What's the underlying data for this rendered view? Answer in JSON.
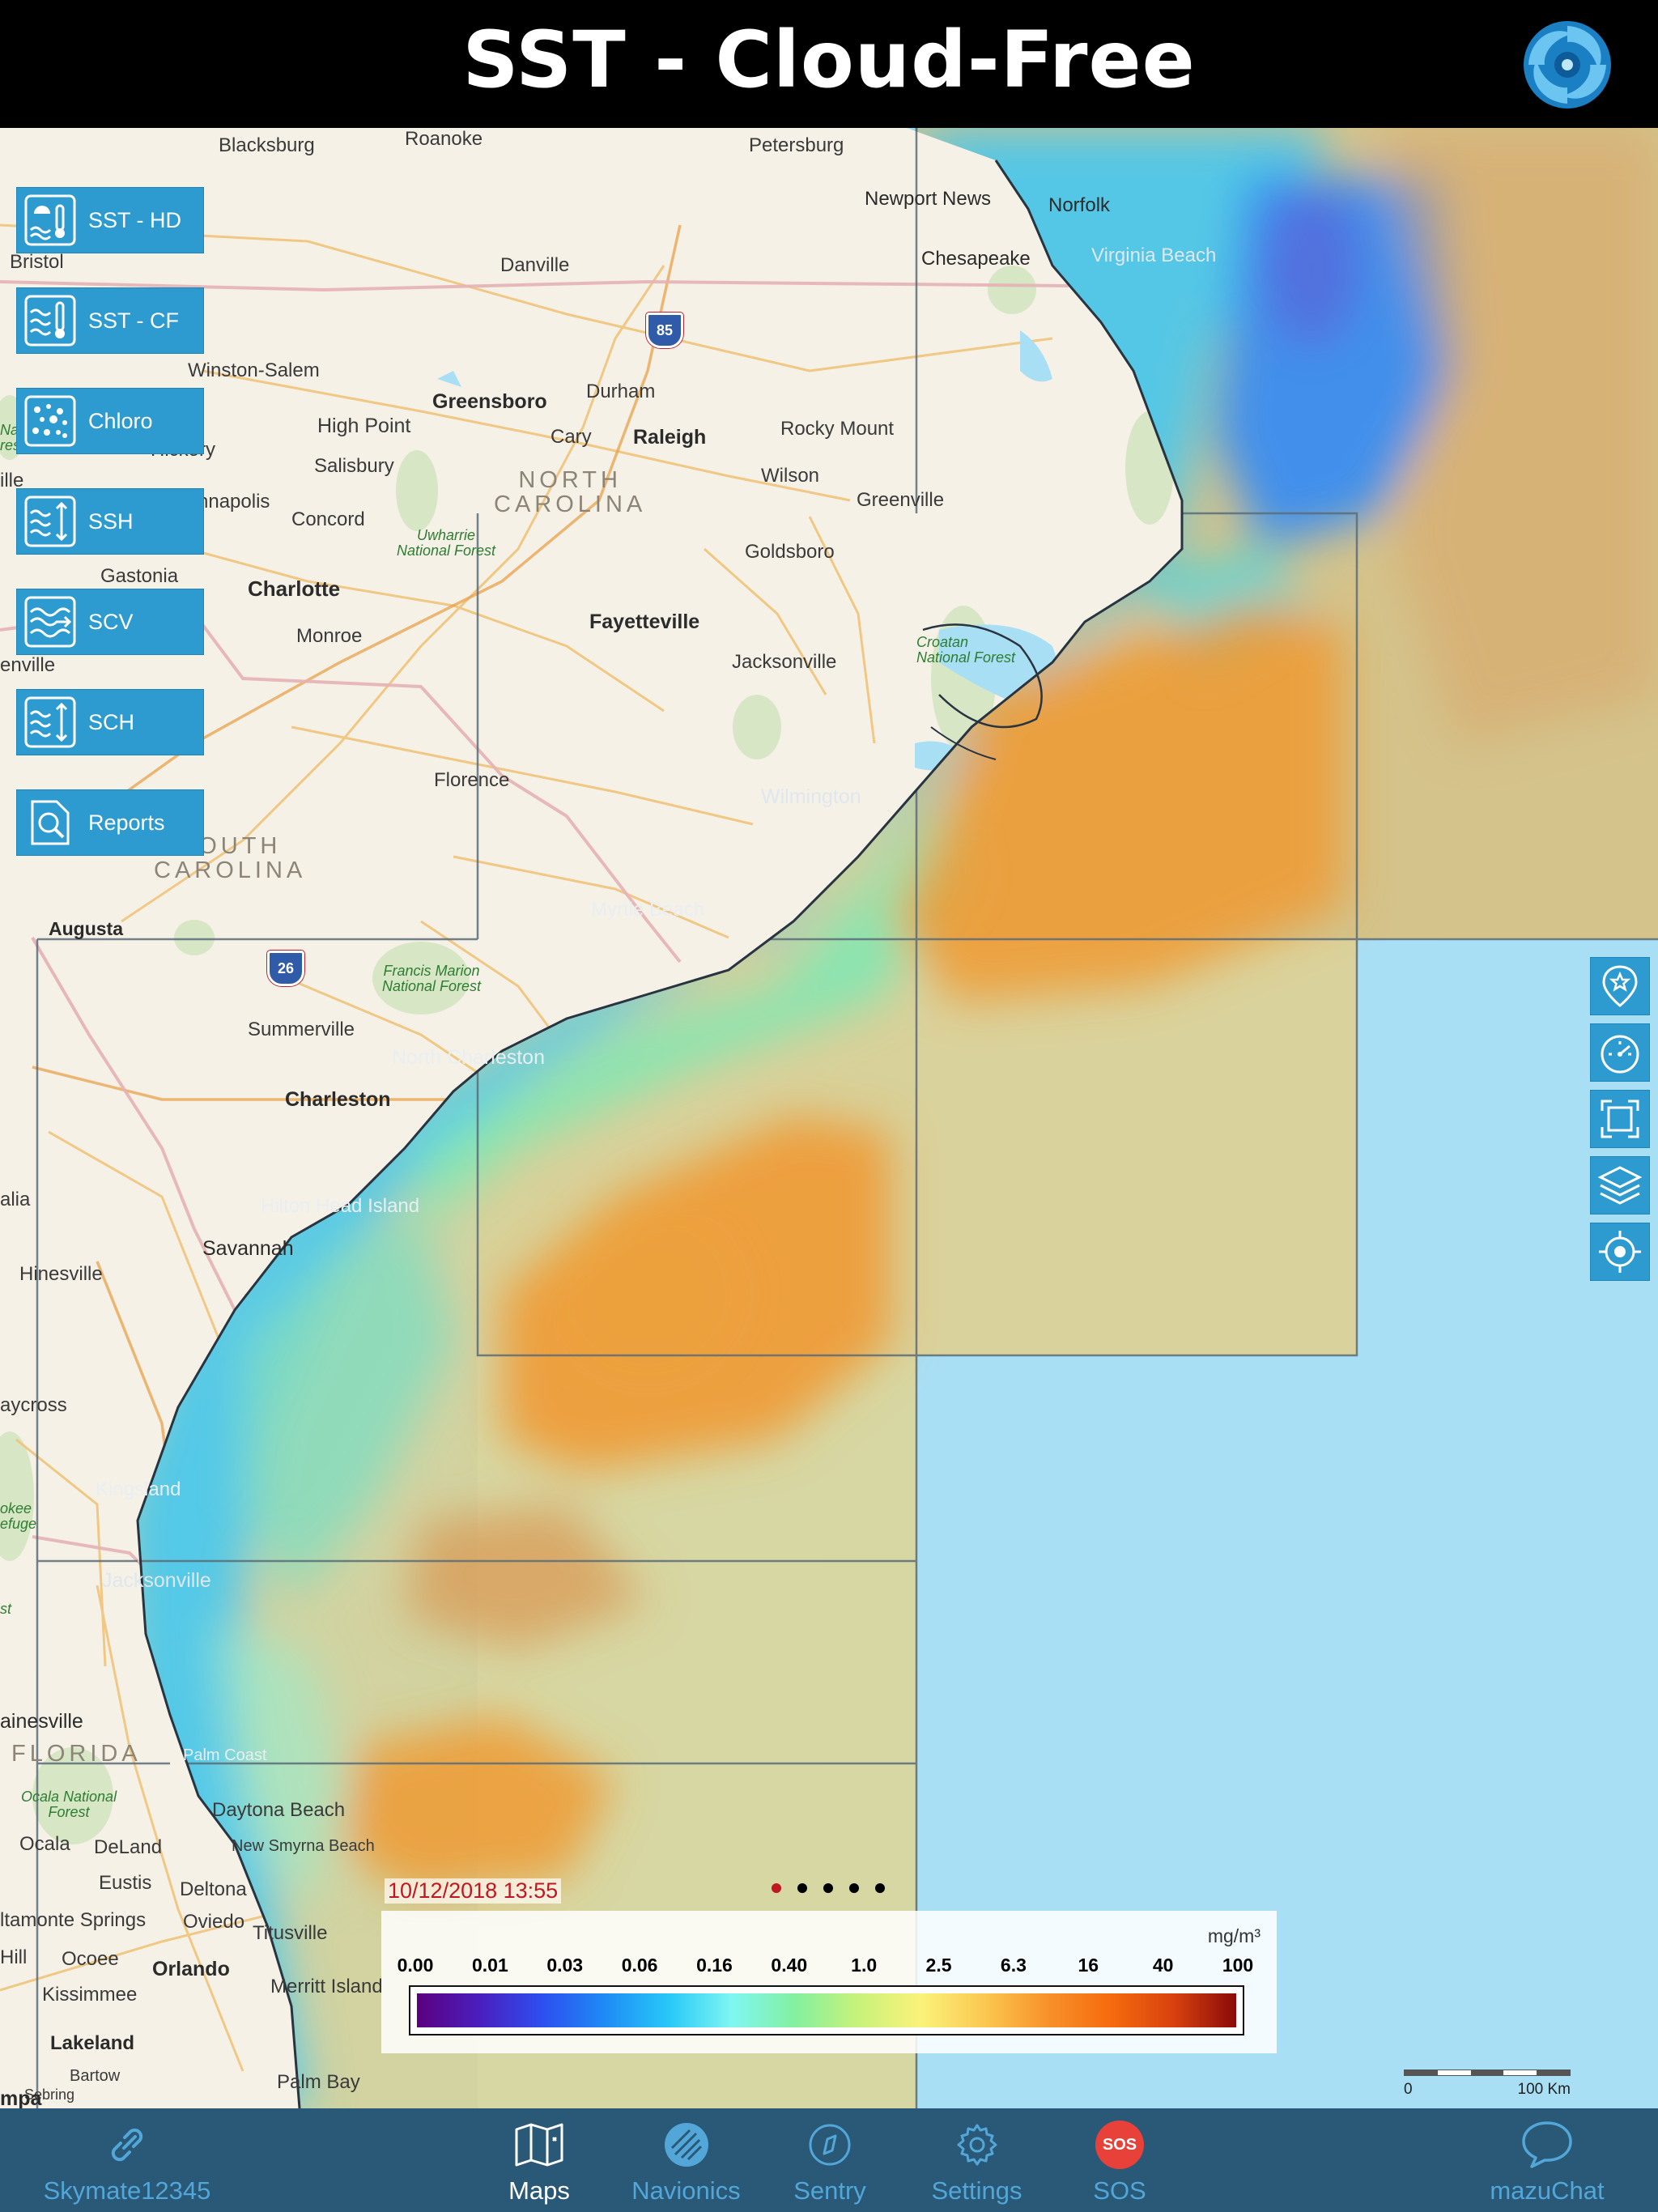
{
  "header": {
    "title": "SST - Cloud-Free",
    "logo_icon": "swirl-logo-icon"
  },
  "left_buttons": [
    {
      "label": "SST - HD",
      "icon": "thermometer-sun-icon"
    },
    {
      "label": "SST - CF",
      "icon": "thermometer-waves-icon"
    },
    {
      "label": "Chloro",
      "icon": "dots-icon"
    },
    {
      "label": "SSH",
      "icon": "waves-updown-icon"
    },
    {
      "label": "SCV",
      "icon": "waves-arrow-icon"
    },
    {
      "label": "SCH",
      "icon": "waves-updown-icon"
    },
    {
      "label": "Reports",
      "icon": "document-search-icon"
    }
  ],
  "right_buttons": [
    {
      "icon": "pin-star-icon"
    },
    {
      "icon": "speedometer-icon"
    },
    {
      "icon": "fullscreen-icon"
    },
    {
      "icon": "layers-icon"
    },
    {
      "icon": "locate-crosshair-icon"
    }
  ],
  "map": {
    "labels": {
      "blacksburg": "Blacksburg",
      "roanoke": "Roanoke",
      "petersburg": "Petersburg",
      "newport_news": "Newport News",
      "norfolk": "Norfolk",
      "chesapeake": "Chesapeake",
      "virginia_beach": "Virginia Beach",
      "bristol": "Bristol",
      "danville": "Danville",
      "winston_salem": "Winston-Salem",
      "durham": "Durham",
      "greensboro": "Greensboro",
      "high_point": "High Point",
      "cary": "Cary",
      "raleigh": "Raleigh",
      "rocky_mount": "Rocky Mount",
      "hickory": "Hickory",
      "salisbury": "Salisbury",
      "wilson": "Wilson",
      "greenville_nc": "Greenville",
      "kannapolis": "nnapolis",
      "concord": "Concord",
      "north_carolina": "NORTH\nCAROLINA",
      "uwharrie": "Uwharrie\nNational Forest",
      "gastonia": "Gastonia",
      "goldsboro": "Goldsboro",
      "charlotte": "Charlotte",
      "fayetteville": "Fayetteville",
      "monroe": "Monroe",
      "jacksonville_nc": "Jacksonville",
      "croatan": "Croatan\nNational Forest",
      "greenville_sc": "enville",
      "florence": "Florence",
      "wilmington": "Wilmington",
      "south_carolina": "SOUTH\nCAROLINA",
      "augusta": "Augusta",
      "myrtle_beach": "Myrtle Beach",
      "francis_marion": "Francis Marion\nNational Forest",
      "summerville": "Summerville",
      "north_charleston": "North Charleston",
      "charleston": "Charleston",
      "hilton_head": "Hilton Head Island",
      "savannah": "Savannah",
      "alia": "alia",
      "hinesville": "Hinesville",
      "waycross": "aycross",
      "kingsland": "Kingsland",
      "okefenokee": "okee\nefuge",
      "jacksonville_fl": "Jacksonville",
      "st": "st",
      "gainesville": "ainesville",
      "florida": "FLORIDA",
      "palm_coast": "Palm Coast",
      "ocala_forest": "Ocala National\nForest",
      "daytona": "Daytona Beach",
      "ocala": "Ocala",
      "deland": "DeLand",
      "new_smyrna": "New Smyrna Beach",
      "eustis": "Eustis",
      "deltona": "Deltona",
      "altamonte": "ltamonte Springs",
      "oviedo": "Oviedo",
      "titusville": "Titusville",
      "ocoee": "Ocoee",
      "orlando": "Orlando",
      "hill": "Hill",
      "kissimmee": "Kissimmee",
      "merritt_island": "Merritt Island",
      "lakeland": "Lakeland",
      "bartow": "Bartow",
      "palm_bay": "Palm Bay",
      "sebring": "Sebring",
      "tampa": "mpa",
      "interstate_85": "85",
      "interstate_26": "26",
      "nat_left": "Na\nres",
      "ille": "ille"
    }
  },
  "legend": {
    "timestamp": "10/12/2018 13:55",
    "unit": "mg/m³",
    "ticks": [
      "0.00",
      "0.01",
      "0.03",
      "0.06",
      "0.16",
      "0.40",
      "1.0",
      "2.5",
      "6.3",
      "16",
      "40",
      "100"
    ],
    "colors": [
      "#5b007f",
      "#2d4ff0",
      "#7ff6f2",
      "#84f0a0",
      "#fbf27a",
      "#f7922a",
      "#8b0a0a"
    ],
    "page_dots": [
      "active",
      "inactive",
      "inactive",
      "inactive",
      "inactive"
    ],
    "active_dot_color": "#c01822"
  },
  "scale_bar": {
    "start": "0",
    "end": "100 Km"
  },
  "tabbar": {
    "account": {
      "label": "Skymate12345",
      "icon": "link-icon"
    },
    "tabs": [
      {
        "label": "Maps",
        "icon": "map-icon",
        "active": true
      },
      {
        "label": "Navionics",
        "icon": "navionics-icon"
      },
      {
        "label": "Sentry",
        "icon": "compass-icon"
      },
      {
        "label": "Settings",
        "icon": "gear-icon"
      },
      {
        "label": "SOS",
        "icon": "sos-icon",
        "badge": "SOS"
      }
    ],
    "chat": {
      "label": "mazuChat",
      "icon": "chat-bubble-icon"
    }
  },
  "colors": {
    "header_bg": "#000000",
    "button_blue": "#2d9bd0",
    "tabbar_bg": "#2a5978",
    "tab_label": "#52a6d8",
    "ocean": "#a9dff4"
  }
}
